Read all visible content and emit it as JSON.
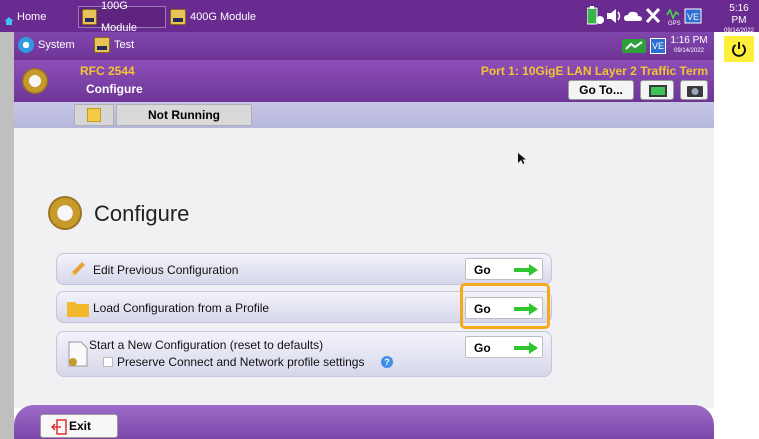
{
  "topbar": {
    "home": "Home",
    "tab1": "100G Module",
    "tab2": "400G Module",
    "gps": "GPS",
    "time": "5:16 PM",
    "date": "09/14/2022"
  },
  "appbar": {
    "system": "System",
    "test": "Test",
    "time": "1:16 PM",
    "date": "09/14/2022"
  },
  "header": {
    "test_name": "RFC 2544",
    "page": "Configure",
    "port": "Port 1: 10GigE LAN Layer 2 Traffic Term",
    "goto": "Go To..."
  },
  "status": {
    "text": "Not Running"
  },
  "main": {
    "title": "Configure",
    "rows": [
      {
        "label": "Edit Previous Configuration",
        "go": "Go"
      },
      {
        "label": "Load Configuration from a Profile",
        "go": "Go"
      },
      {
        "label": "Start a New Configuration (reset to defaults)",
        "go": "Go",
        "checkbox_label": "Preserve Connect and Network profile settings"
      }
    ]
  },
  "footer": {
    "exit": "Exit"
  },
  "colors": {
    "purple": "#6a2b91",
    "highlight": "#f4a81c",
    "arrow": "#2ec62e",
    "power": "#ffef3a"
  }
}
